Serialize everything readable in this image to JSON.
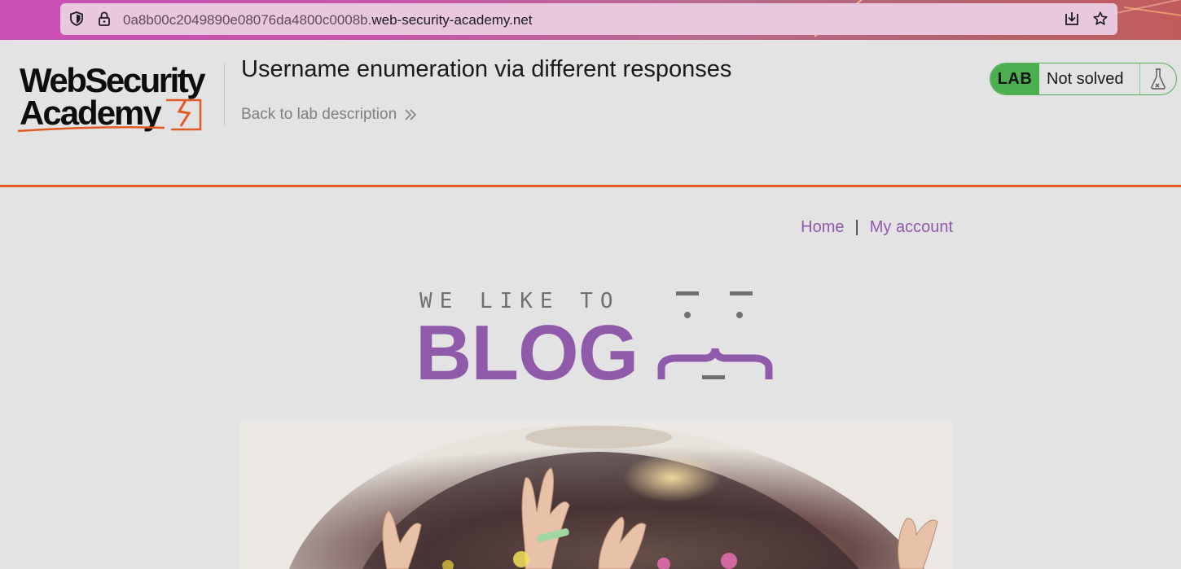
{
  "browser": {
    "url_prefix": "0a8b00c2049890e08076da4800c0008b.",
    "url_domain": "web-security-academy.net",
    "icons": [
      "shield-icon",
      "lock-icon",
      "download-icon",
      "star-icon"
    ]
  },
  "lab_header": {
    "logo_line1": "WebSecurity",
    "logo_line2": "Academy",
    "title": "Username enumeration via different responses",
    "back_link": "Back to lab description",
    "status_badge": "LAB",
    "status_text": "Not solved",
    "accent_color": "#e05a24",
    "status_color": "#4caf50"
  },
  "blog": {
    "nav": {
      "home": "Home",
      "separator": "|",
      "account": "My account"
    },
    "logo_top": "WE LIKE TO",
    "logo_main": "BLOG",
    "brand_color": "#8f5aaa"
  }
}
